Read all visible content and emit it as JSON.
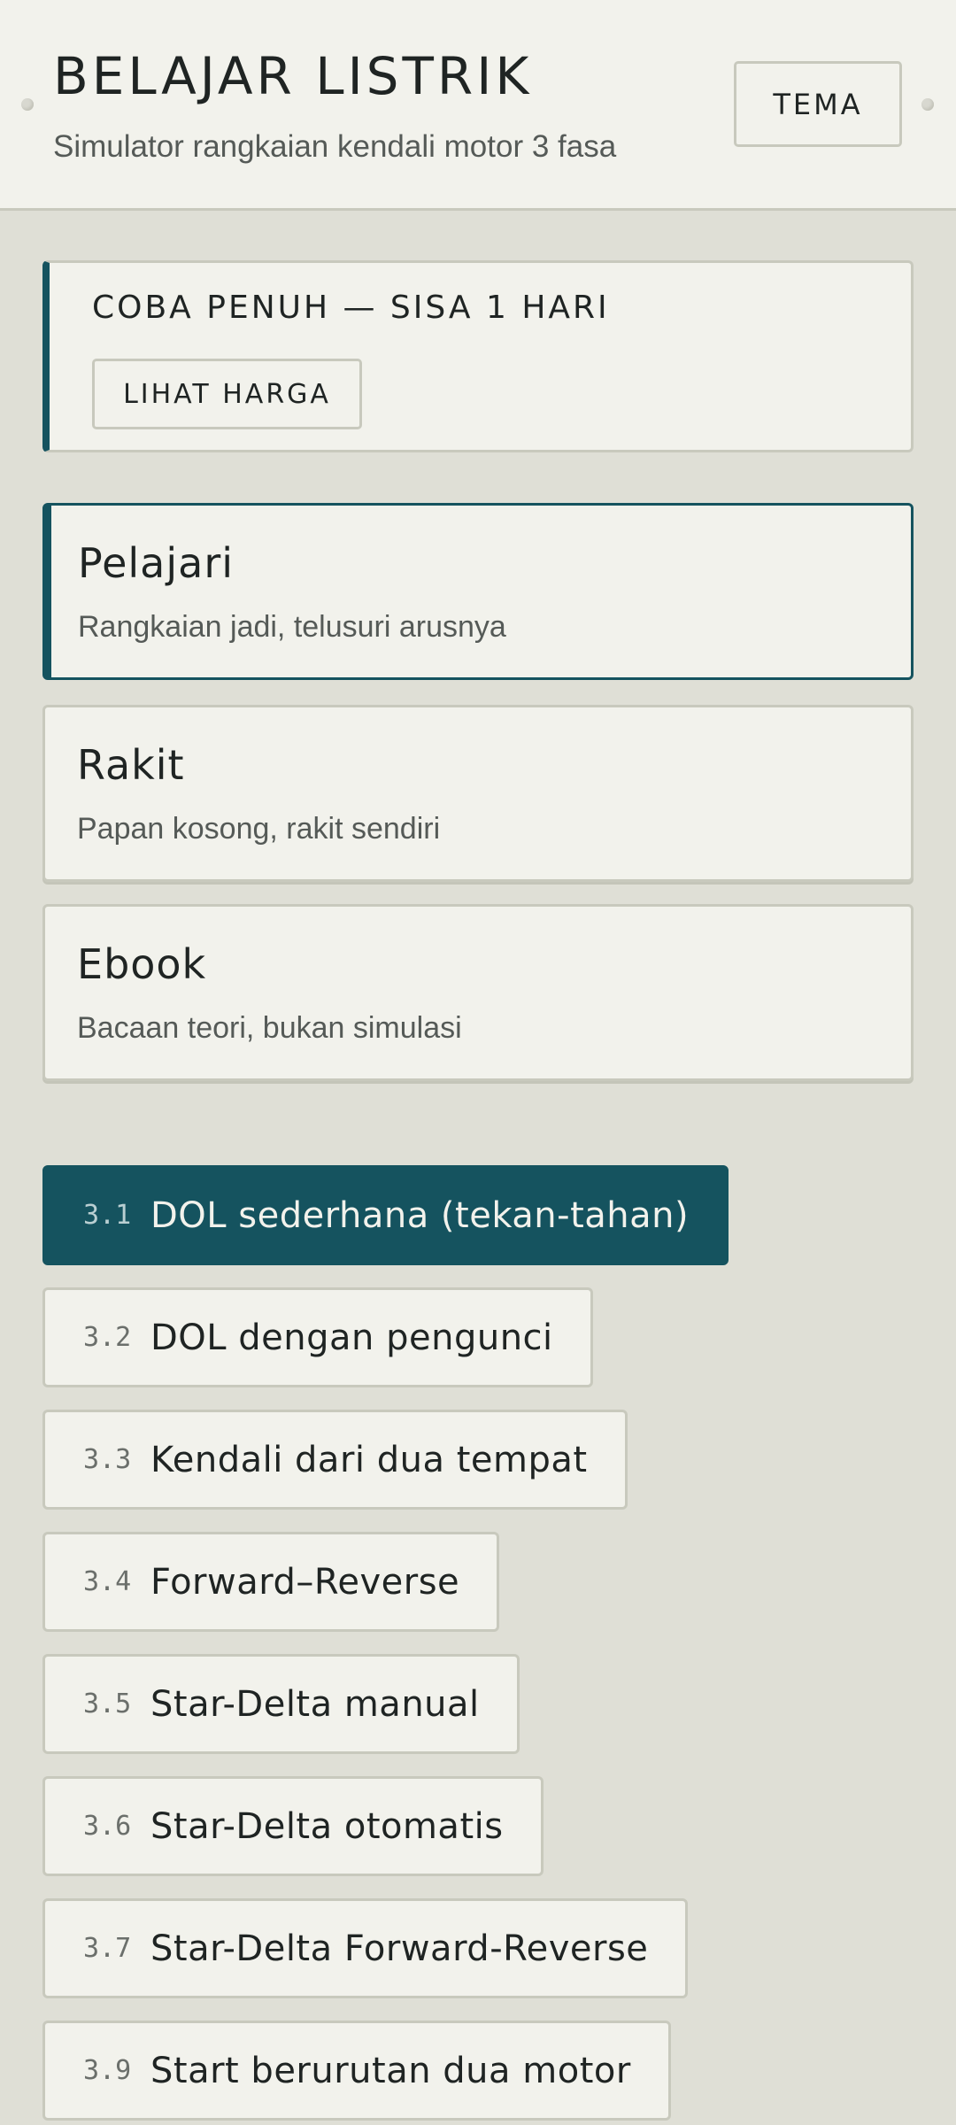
{
  "header": {
    "title": "BELAJAR LISTRIK",
    "subtitle": "Simulator rangkaian kendali motor 3 fasa",
    "theme_button": "TEMA"
  },
  "trial": {
    "title": "COBA PENUH — SISA 1 HARI",
    "price_button": "LIHAT HARGA"
  },
  "modes": [
    {
      "title": "Pelajari",
      "description": "Rangkaian jadi, telusuri arusnya",
      "active": true
    },
    {
      "title": "Rakit",
      "description": "Papan kosong, rakit sendiri",
      "active": false
    },
    {
      "title": "Ebook",
      "description": "Bacaan teori, bukan simulasi",
      "active": false
    }
  ],
  "lessons": [
    {
      "number": "3.1",
      "title": "DOL sederhana (tekan-tahan)",
      "active": true
    },
    {
      "number": "3.2",
      "title": "DOL dengan pengunci",
      "active": false
    },
    {
      "number": "3.3",
      "title": "Kendali dari dua tempat",
      "active": false
    },
    {
      "number": "3.4",
      "title": "Forward–Reverse",
      "active": false
    },
    {
      "number": "3.5",
      "title": "Star-Delta manual",
      "active": false
    },
    {
      "number": "3.6",
      "title": "Star-Delta otomatis",
      "active": false
    },
    {
      "number": "3.7",
      "title": "Star-Delta Forward-Reverse",
      "active": false
    },
    {
      "number": "3.9",
      "title": "Start berurutan dua motor",
      "active": false
    }
  ],
  "colors": {
    "accent": "#15535f",
    "background": "#dfdfd6",
    "card": "#f2f2ec",
    "border": "#c8c9bd"
  }
}
